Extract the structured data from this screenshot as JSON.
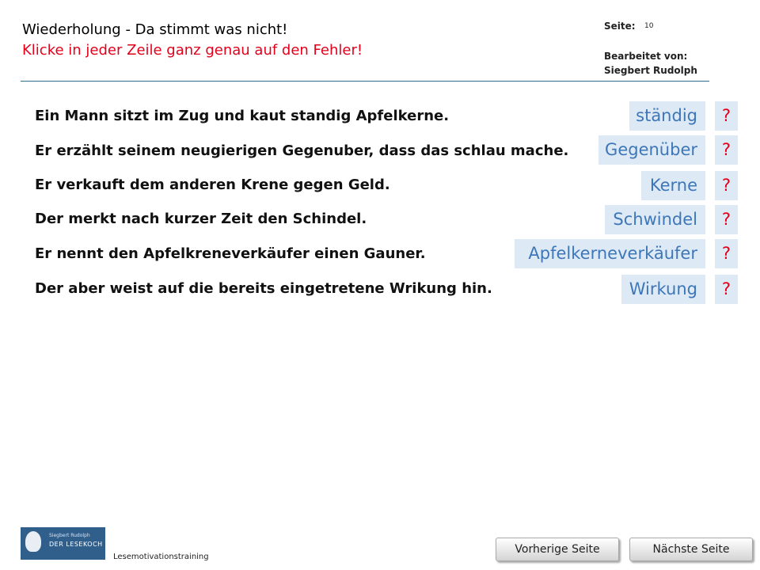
{
  "header": {
    "title": "Wiederholung  - Da stimmt was nicht!",
    "instruction": "Klicke in jeder Zeile ganz genau auf den Fehler!",
    "page_label": "Seite:",
    "page_number": "10",
    "editor_label": "Bearbeitet von:",
    "editor_name": "Siegbert Rudolph"
  },
  "rows": [
    {
      "sentence": "Ein Mann sitzt im Zug und kaut standig Apfelkerne.",
      "answer": "ständig",
      "hint": "?"
    },
    {
      "sentence": "Er erzählt seinem neugierigen Gegenuber, dass das schlau mache.",
      "answer": "Gegenüber",
      "hint": "?"
    },
    {
      "sentence": "Er verkauft dem anderen Krene gegen Geld.",
      "answer": "Kerne",
      "hint": "?"
    },
    {
      "sentence": "Der merkt nach kurzer Zeit den Schindel.",
      "answer": "Schwindel",
      "hint": "?"
    },
    {
      "sentence": "Er nennt den Apfelkreneverkäufer einen Gauner.",
      "answer": "Apfelkerneverkäufer",
      "hint": "?"
    },
    {
      "sentence": "Der aber weist auf die bereits eingetretene Wrikung hin.",
      "answer": "Wirkung",
      "hint": "?"
    }
  ],
  "footer": {
    "logo_top": "Siegbert Rudolph",
    "logo_text": "DER LESEKOCH",
    "label": "Lesemotivationstraining",
    "prev_button": "Vorherige Seite",
    "next_button": "Nächste Seite"
  },
  "colors": {
    "instruction": "#e3001b",
    "answer_text": "#3d77b8",
    "answer_background": "#dde9f5",
    "rule": "#2e6f8e"
  }
}
